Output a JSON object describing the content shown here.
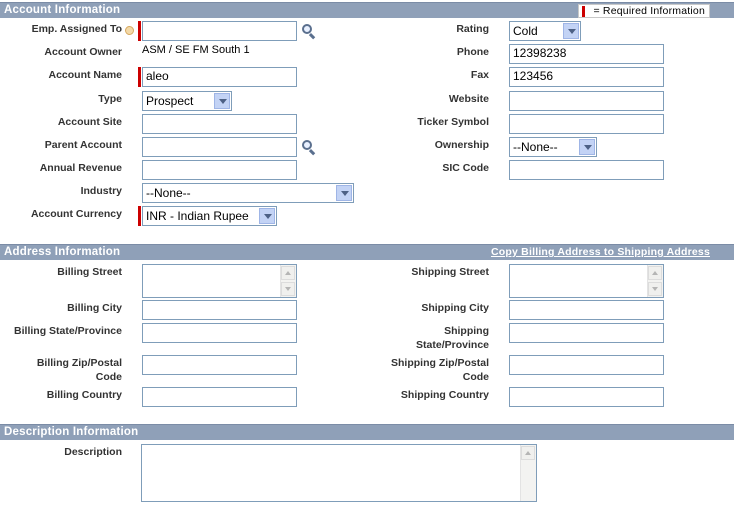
{
  "account_info": {
    "title": "Account Information",
    "required_legend": "= Required Information",
    "left": {
      "emp_assigned_to": {
        "label": "Emp. Assigned To",
        "value": ""
      },
      "account_owner": {
        "label": "Account Owner",
        "value": "ASM / SE FM South 1"
      },
      "account_name": {
        "label": "Account Name",
        "value": "aleo"
      },
      "type": {
        "label": "Type",
        "value": "Prospect"
      },
      "account_site": {
        "label": "Account Site",
        "value": ""
      },
      "parent_account": {
        "label": "Parent Account",
        "value": ""
      },
      "annual_revenue": {
        "label": "Annual Revenue",
        "value": ""
      },
      "industry": {
        "label": "Industry",
        "value": "--None--"
      },
      "account_currency": {
        "label": "Account Currency",
        "value": "INR - Indian Rupee"
      }
    },
    "right": {
      "rating": {
        "label": "Rating",
        "value": "Cold"
      },
      "phone": {
        "label": "Phone",
        "value": "12398238"
      },
      "fax": {
        "label": "Fax",
        "value": "123456"
      },
      "website": {
        "label": "Website",
        "value": ""
      },
      "ticker_symbol": {
        "label": "Ticker Symbol",
        "value": ""
      },
      "ownership": {
        "label": "Ownership",
        "value": "--None--"
      },
      "sic_code": {
        "label": "SIC Code",
        "value": ""
      }
    }
  },
  "address_info": {
    "title": "Address Information",
    "copy_link": "Copy Billing Address to Shipping Address",
    "billing_street": {
      "label": "Billing Street",
      "value": ""
    },
    "billing_city": {
      "label": "Billing City",
      "value": ""
    },
    "billing_state": {
      "label": "Billing State/Province",
      "value": ""
    },
    "billing_zip_line1": "Billing Zip/Postal",
    "billing_zip_line2": "Code",
    "billing_zip_value": "",
    "billing_country": {
      "label": "Billing Country",
      "value": ""
    },
    "shipping_street": {
      "label": "Shipping Street",
      "value": ""
    },
    "shipping_city": {
      "label": "Shipping City",
      "value": ""
    },
    "shipping_state_line1": "Shipping",
    "shipping_state_line2": "State/Province",
    "shipping_state_value": "",
    "shipping_zip_line1": "Shipping Zip/Postal",
    "shipping_zip_line2": "Code",
    "shipping_zip_value": "",
    "shipping_country": {
      "label": "Shipping Country",
      "value": ""
    }
  },
  "description_info": {
    "title": "Description Information",
    "description": {
      "label": "Description",
      "value": ""
    }
  },
  "colors": {
    "section_header": "#8fa0b8",
    "required": "#cc0000",
    "input_border": "#7f9db9"
  },
  "icons": {
    "lookup": "lookup-icon",
    "help": "help-icon",
    "dropdown": "chevron-down-icon"
  }
}
